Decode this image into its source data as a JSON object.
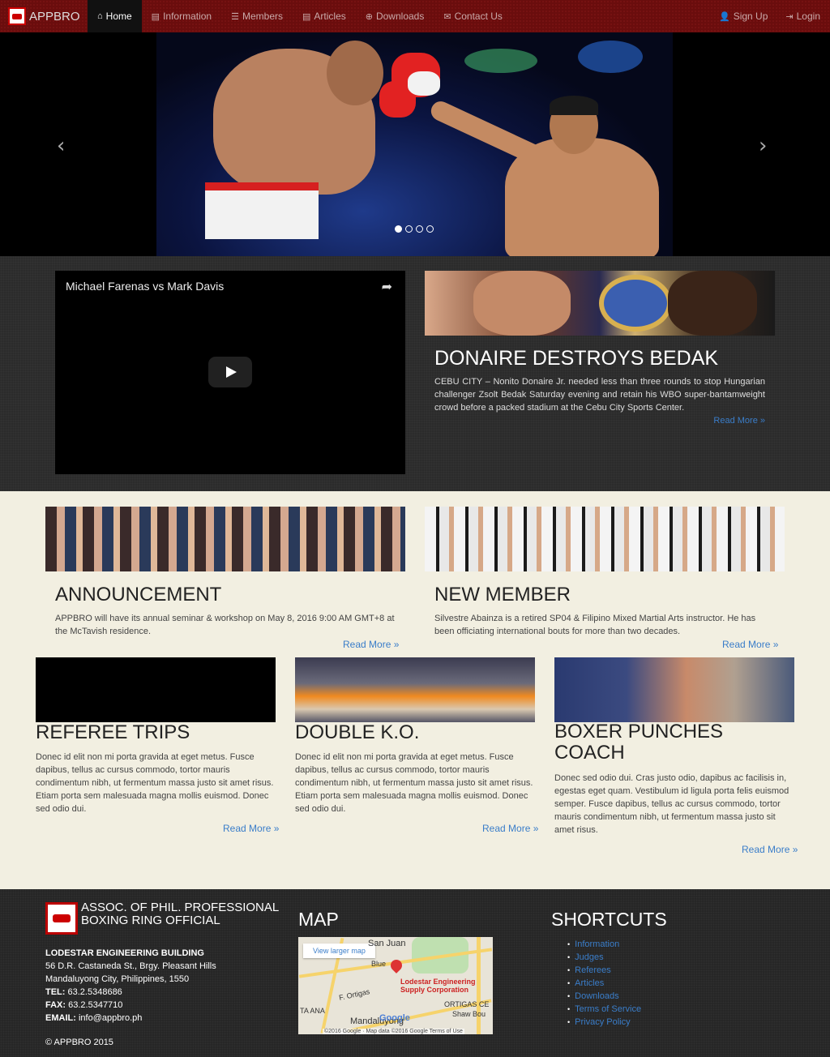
{
  "nav": {
    "brand": "APPBRO",
    "items": [
      {
        "icon": "home-icon",
        "glyph": "⌂",
        "label": "Home",
        "active": true
      },
      {
        "icon": "book-icon",
        "glyph": "▤",
        "label": "Information"
      },
      {
        "icon": "list-icon",
        "glyph": "☰",
        "label": "Members"
      },
      {
        "icon": "file-icon",
        "glyph": "▤",
        "label": "Articles"
      },
      {
        "icon": "download-icon",
        "glyph": "⊕",
        "label": "Downloads"
      },
      {
        "icon": "envelope-icon",
        "glyph": "✉",
        "label": "Contact Us"
      }
    ],
    "right": [
      {
        "icon": "user-icon",
        "glyph": "👤",
        "label": "Sign Up"
      },
      {
        "icon": "login-icon",
        "glyph": "⇥",
        "label": "Login"
      }
    ]
  },
  "carousel": {
    "prev_glyph": "‹",
    "next_glyph": "›",
    "slide_count": 4,
    "active_index": 0
  },
  "video": {
    "title": "Michael Farenas vs Mark Davis",
    "share_glyph": "➦"
  },
  "feature": {
    "title": "DONAIRE DESTROYS BEDAK",
    "text": "CEBU CITY – Nonito Donaire Jr. needed less than three rounds to stop Hungarian challenger Zsolt Bedak Saturday evening and retain his WBO super-bantamweight crowd before a packed stadium at the Cebu City Sports Center.",
    "more": "Read More »"
  },
  "cards_top": [
    {
      "title": "ANNOUNCEMENT",
      "text": "APPBRO will have its annual seminar & workshop on May 8, 2016 9:00 AM GMT+8 at the McTavish residence.",
      "more": "Read More »"
    },
    {
      "title": "NEW MEMBER",
      "text": "Silvestre Abainza is a retired SP04 & Filipino Mixed Martial Arts instructor. He has been officiating international bouts for more than two decades.",
      "more": "Read More »"
    }
  ],
  "cards_bottom": [
    {
      "title": "REFEREE TRIPS",
      "text": "Donec id elit non mi porta gravida at eget metus. Fusce dapibus, tellus ac cursus commodo, tortor mauris condimentum nibh, ut fermentum massa justo sit amet risus. Etiam porta sem malesuada magna mollis euismod. Donec sed odio dui.",
      "more": "Read More »"
    },
    {
      "title": "DOUBLE K.O.",
      "text": "Donec id elit non mi porta gravida at eget metus. Fusce dapibus, tellus ac cursus commodo, tortor mauris condimentum nibh, ut fermentum massa justo sit amet risus. Etiam porta sem malesuada magna mollis euismod. Donec sed odio dui.",
      "more": "Read More »"
    },
    {
      "title": "BOXER PUNCHES COACH",
      "text": "Donec sed odio dui. Cras justo odio, dapibus ac facilisis in, egestas eget quam. Vestibulum id ligula porta felis euismod semper. Fusce dapibus, tellus ac cursus commodo, tortor mauris condimentum nibh, ut fermentum massa justo sit amet risus.",
      "more": "Read More »"
    }
  ],
  "footer": {
    "org": "ASSOC. OF PHIL. PROFESSIONAL BOXING RING OFFICIAL",
    "building": "LODESTAR ENGINEERING BUILDING",
    "addr1": "56 D.R. Castaneda St., Brgy. Pleasant Hills",
    "addr2": "Mandaluyong City, Philippines, 1550",
    "tel_label": "TEL:",
    "tel": "63.2.5348686",
    "fax_label": "FAX:",
    "fax": "63.2.5347710",
    "email_label": "EMAIL:",
    "email": "info@appbro.ph",
    "copyright": "© APPBRO 2015",
    "map_heading": "MAP",
    "map": {
      "larger": "View larger map",
      "san_juan": "San Juan",
      "blue": "Blue",
      "biz": "Lodestar Engineering",
      "biz2": "Supply Corporation",
      "ortigas": "ORTIGAS CE",
      "shaw": "Shaw Bou",
      "f_ortigas": "F. Ortigas",
      "mandaluyong": "Mandaluyong",
      "ta_ana": "TA ANA",
      "google": "Google",
      "attrib": "©2016 Google · Map data ©2016 Google    Terms of Use"
    },
    "shortcuts_heading": "SHORTCUTS",
    "shortcuts": [
      "Information",
      "Judges",
      "Referees",
      "Articles",
      "Downloads",
      "Terms of Service",
      "Privacy Policy"
    ]
  }
}
